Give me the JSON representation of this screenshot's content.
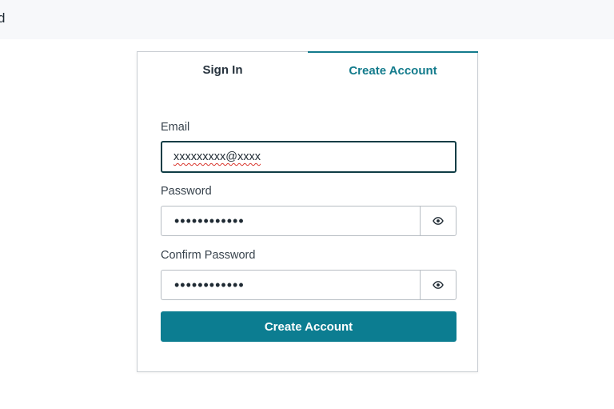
{
  "header": {
    "partial_text": "d"
  },
  "tabs": {
    "sign_in": "Sign In",
    "create_account": "Create Account",
    "active": "create_account"
  },
  "form": {
    "email_label": "Email",
    "email_value": "xxxxxxxxx@xxxx",
    "password_label": "Password",
    "password_value": "••••••••••••",
    "confirm_label": "Confirm Password",
    "confirm_value": "••••••••••••",
    "submit_label": "Create Account"
  },
  "colors": {
    "accent": "#0c7d91",
    "active_tab_text": "#137b8c",
    "focus_border": "#0f3d45",
    "spellcheck_underline": "#d9352c"
  },
  "icons": {
    "show_password": "eye-icon"
  }
}
